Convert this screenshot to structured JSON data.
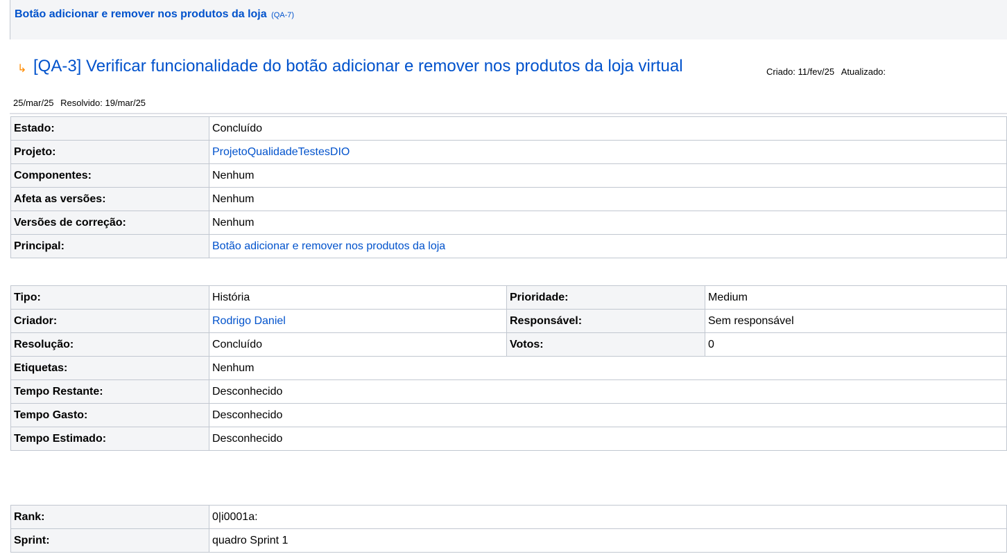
{
  "parent": {
    "title": "Botão adicionar e remover nos produtos da loja",
    "key": "(QA-7)"
  },
  "issue": {
    "subtask_icon": "subtask-arrow-icon",
    "key": "[QA-3]",
    "title": "Verificar funcionalidade do botão adicionar e remover nos produtos da loja virtual",
    "created_label": "Criado:",
    "created": "11/fev/25",
    "updated_label": "Atualizado:",
    "updated": "25/mar/25",
    "resolved_label": "Resolvido:",
    "resolved": "19/mar/25"
  },
  "details": [
    {
      "label": "Estado:",
      "value": "Concluído",
      "link": false
    },
    {
      "label": "Projeto:",
      "value": "ProjetoQualidadeTestesDIO",
      "link": true
    },
    {
      "label": "Componentes:",
      "value": "Nenhum",
      "link": false
    },
    {
      "label": "Afeta as versões:",
      "value": "Nenhum",
      "link": false
    },
    {
      "label": "Versões de correção:",
      "value": "Nenhum",
      "link": false
    },
    {
      "label": "Principal:",
      "value": "Botão adicionar e remover nos produtos da loja",
      "link": true
    }
  ],
  "attributes": {
    "tipo_label": "Tipo:",
    "tipo": "História",
    "prioridade_label": "Prioridade:",
    "prioridade": "Medium",
    "criador_label": "Criador:",
    "criador": "Rodrigo Daniel",
    "responsavel_label": "Responsável:",
    "responsavel": "Sem responsável",
    "resolucao_label": "Resolução:",
    "resolucao": "Concluído",
    "votos_label": "Votos:",
    "votos": "0",
    "etiquetas_label": "Etiquetas:",
    "etiquetas": "Nenhum",
    "restante_label": "Tempo Restante:",
    "restante": "Desconhecido",
    "gasto_label": "Tempo Gasto:",
    "gasto": "Desconhecido",
    "estimado_label": "Tempo Estimado:",
    "estimado": "Desconhecido"
  },
  "extra": [
    {
      "label": "Rank:",
      "value": "0|i0001a:"
    },
    {
      "label": "Sprint:",
      "value": "quadro Sprint 1"
    }
  ],
  "colors": {
    "link": "#0052cc",
    "label_bg": "#f4f5f7",
    "border": "#c1c7d0",
    "subtask_icon": "#ff8b00"
  }
}
